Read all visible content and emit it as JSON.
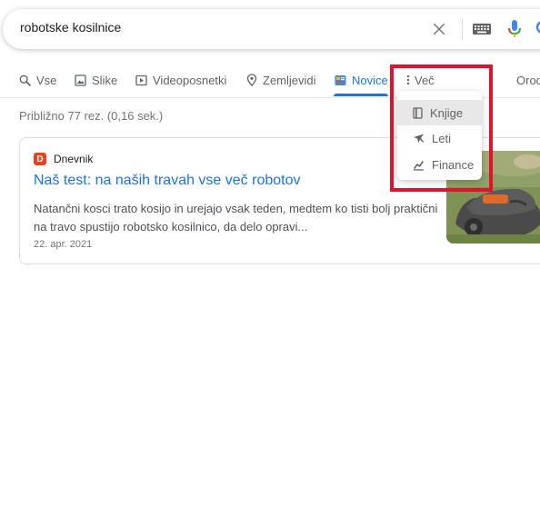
{
  "search": {
    "query": "robotske kosilnice"
  },
  "tabs": [
    {
      "label": "Vse",
      "icon": "search-icon"
    },
    {
      "label": "Slike",
      "icon": "image-icon"
    },
    {
      "label": "Videoposnetki",
      "icon": "video-icon"
    },
    {
      "label": "Zemljevidi",
      "icon": "map-pin-icon"
    },
    {
      "label": "Novice",
      "icon": "news-icon",
      "active": true
    },
    {
      "label": "Več",
      "icon": "more-vert-icon"
    },
    {
      "label": "Orod",
      "icon": null
    }
  ],
  "result_stats": "Približno 77 rez. (0,16 sek.)",
  "news": {
    "source": "Dnevnik",
    "source_logo_letter": "D",
    "title": "Naš test: na naših travah vse več robotov",
    "snippet": "Natančni kosci trato kosijo in urejajo vsak teden, medtem ko tisti bolj praktični na travo spustijo robotsko kosilnico, da delo opravi...",
    "date": "22. apr. 2021"
  },
  "more_menu": {
    "items": [
      {
        "label": "Knjige",
        "icon": "book-icon"
      },
      {
        "label": "Leti",
        "icon": "airplane-icon"
      },
      {
        "label": "Finance",
        "icon": "finance-icon"
      }
    ]
  },
  "colors": {
    "accent": "#1a73e8",
    "highlight_box": "#e5112b",
    "source_logo": "#e8421f"
  }
}
